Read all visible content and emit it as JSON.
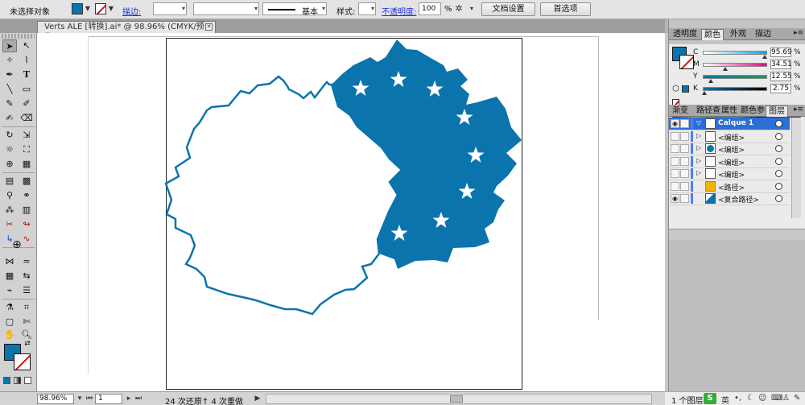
{
  "control_bar": {
    "selection_label": "未选择对象",
    "stroke_label": "描边:",
    "stroke_profile_label": "基本",
    "style_label": "样式:",
    "opacity_label": "不透明度:",
    "opacity_value": "100",
    "opacity_unit": "%",
    "doc_setup_button": "文档设置",
    "preferences_button": "首选项"
  },
  "document_tab": {
    "title": "Verts ALE [转换].ai* @ 98.96% (CMYK/预览)",
    "close": "✕"
  },
  "status_bar": {
    "zoom": "98.96%",
    "page": "1",
    "history": "24 次还原↑ 4 次重做"
  },
  "panels": {
    "top_tabs": [
      "透明度",
      "颜色",
      "外观",
      "描边"
    ],
    "top_active": "颜色",
    "color": {
      "rows": [
        {
          "label": "C",
          "value": "95.69",
          "unit": "%",
          "fraction": 0.9569,
          "from": "#ffffff",
          "to": "#00aeef"
        },
        {
          "label": "M",
          "value": "34.51",
          "unit": "%",
          "fraction": 0.3451,
          "from": "#ffffff",
          "to": "#ec008c"
        },
        {
          "label": "Y",
          "value": "12.55",
          "unit": "%",
          "fraction": 0.1255,
          "from": "#0b74ad",
          "to": "#1b9c4a"
        },
        {
          "label": "K",
          "value": "2.75",
          "unit": "%",
          "fraction": 0.0275,
          "from": "#0b74ad",
          "to": "#000000"
        }
      ]
    },
    "bottom_tabs": [
      "渐变",
      "路径查",
      "属性",
      "颜色参",
      "图层"
    ],
    "bottom_active": "图层",
    "layers": [
      {
        "name": "Calque 1",
        "selected": true
      },
      {
        "name": "<编组>",
        "thumb": "white"
      },
      {
        "name": "<编组>",
        "thumb": "blue-circle"
      },
      {
        "name": "<编组>",
        "thumb": "white"
      },
      {
        "name": "<编组>",
        "thumb": "white"
      },
      {
        "name": "<路径>",
        "thumb": "yellow"
      },
      {
        "name": "<复合路径>",
        "thumb": "blue-shape"
      }
    ]
  },
  "taskbar": {
    "layer_count": "1 个图层",
    "ime_logo": "S",
    "lang": "英"
  },
  "colors": {
    "accent_blue": "#0b74ad",
    "layer_selected": "#2a6fd6"
  }
}
